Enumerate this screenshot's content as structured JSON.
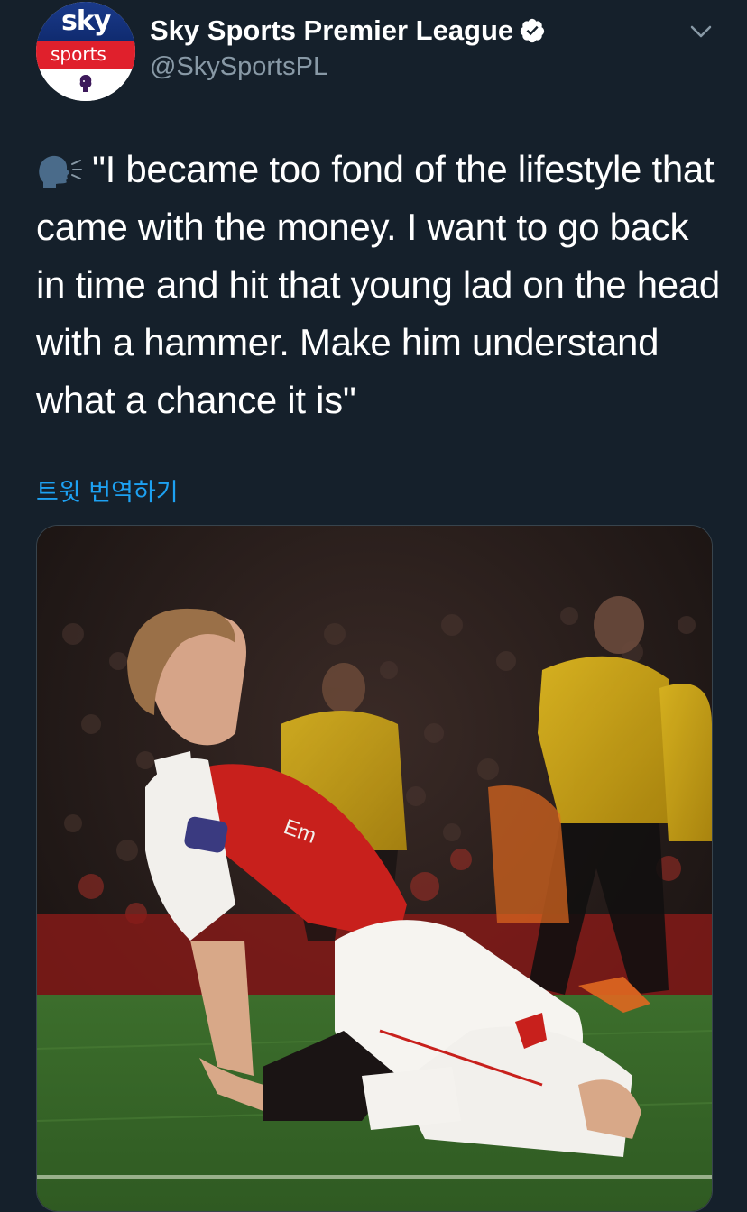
{
  "account": {
    "display_name": "Sky Sports Premier League",
    "handle": "@SkySportsPL",
    "avatar_text_top": "sky",
    "avatar_text_mid": "sports"
  },
  "tweet": {
    "text": "\"I became too fond of the lifestyle that came with the money. I want to go back in time and hit that young lad on the head with a hammer. Make him understand what a chance it is\"",
    "translate_label": "트윗 번역하기"
  },
  "media": {
    "jersey_sponsor_partial": "Em"
  },
  "colors": {
    "background": "#15202b",
    "text": "#ffffff",
    "secondary_text": "#8899a6",
    "link": "#1da1f2",
    "border": "#38444d"
  },
  "icons": {
    "verified": "verified-badge-icon",
    "chevron": "chevron-down-icon",
    "speaking": "speaking-head-icon"
  }
}
